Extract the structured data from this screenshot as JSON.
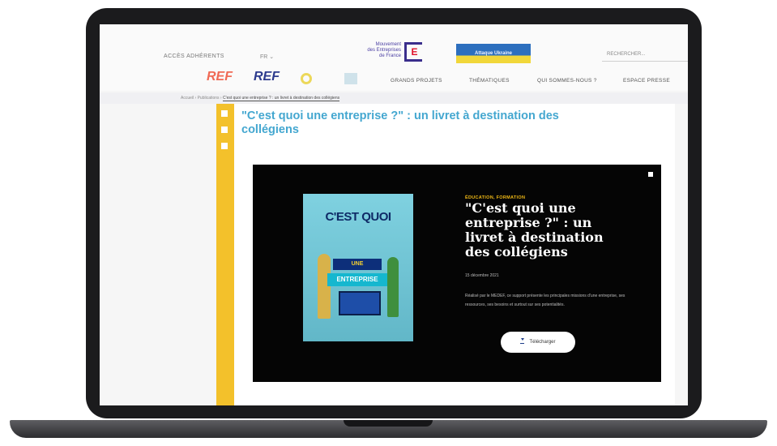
{
  "header": {
    "acces_adherents": "ACCÈS ADHÉRENTS",
    "lang": "FR ⌄",
    "ministere_lines": [
      "Mouvement",
      "des Entreprises",
      "de France"
    ],
    "ministere_e": "E",
    "ukraine_label": "Attaque Ukraine",
    "search_placeholder": "RECHERCHER..."
  },
  "nav": {
    "ref_logo_1": "REF",
    "ref_logo_2": "REF",
    "items": [
      "GRANDS PROJETS",
      "THÉMATIQUES",
      "QUI SOMMES-NOUS ?",
      "ESPACE PRESSE"
    ]
  },
  "breadcrumb": {
    "parts": [
      "Accueil",
      "Publications"
    ],
    "current": "C'est quoi une entreprise ? : un livret à destination des collégiens"
  },
  "page": {
    "title": "\"C'est quoi une entreprise ?\" : un livret à destination des collégiens"
  },
  "modal": {
    "category": "ÉDUCATION, FORMATION",
    "title": "\"C'est quoi une entreprise ?\" : un livret à destination des collégiens",
    "date": "15 décembre 2021",
    "description": "Réalisé par le MEDEF, ce support présente les principales missions d'une entreprise, ses ressources, ses besoins et surtout sur ses potentialités.",
    "download_label": "Télécharger",
    "book": {
      "title": "C'EST QUOI",
      "sub": "UNE",
      "word": "ENTREPRISE"
    }
  },
  "colors": {
    "accent_blue": "#44a7d0",
    "rail_yellow": "#f3c12b",
    "modal_bg": "#050505"
  }
}
